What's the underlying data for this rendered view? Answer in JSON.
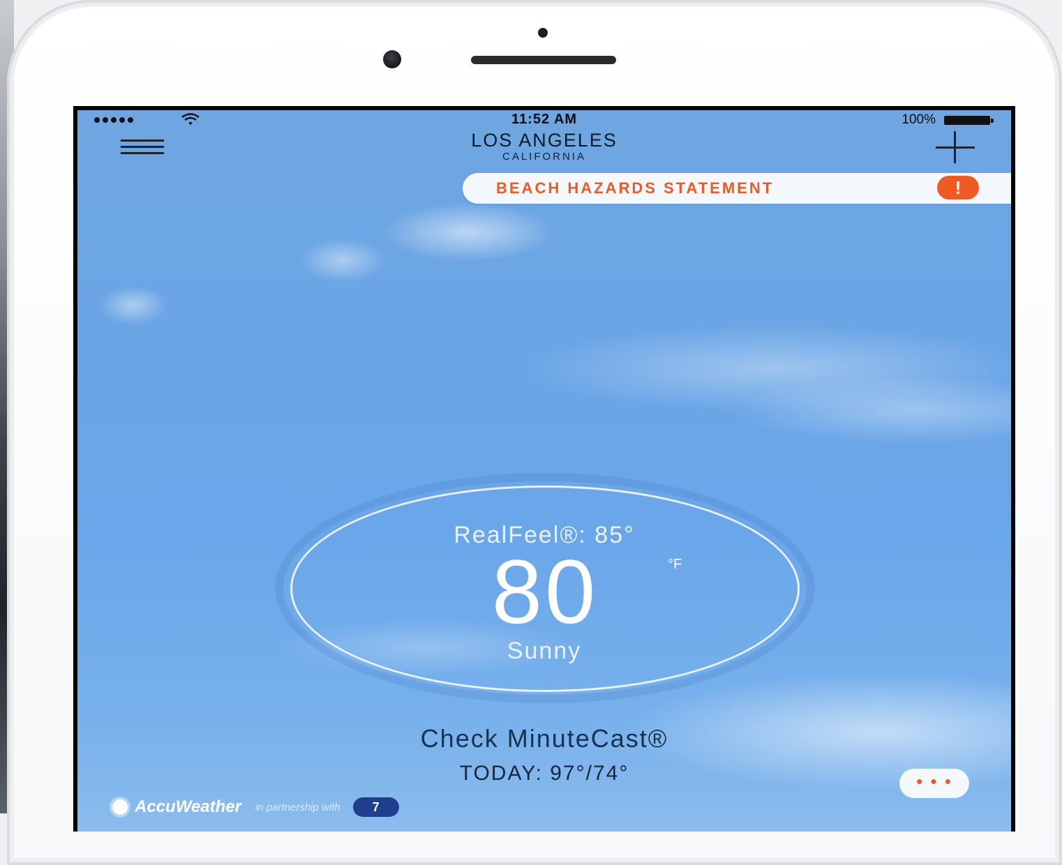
{
  "status_bar": {
    "time": "11:52 AM",
    "battery_percent": "100%",
    "signal_bars": 5
  },
  "header": {
    "city": "LOS ANGELES",
    "region": "CALIFORNIA"
  },
  "alert": {
    "label": "BEACH HAZARDS STATEMENT",
    "icon_glyph": "!"
  },
  "current": {
    "realfeel": "RealFeel®: 85°",
    "temperature": "80",
    "unit": "°F",
    "condition": "Sunny"
  },
  "minutecast_label": "Check MinuteCast®",
  "today_range": "TODAY: 97°/74°",
  "more_glyph": "• • •",
  "footer": {
    "brand": "AccuWeather",
    "partner_text": "in partnership with",
    "partner_logo": "7"
  },
  "colors": {
    "accent": "#ef5a22",
    "sky_top": "#6fa6e2",
    "sky_bottom": "#8bbcec"
  },
  "icons": [
    "menu-icon",
    "add-icon",
    "wifi-icon",
    "battery-icon",
    "alert-icon",
    "sun-icon"
  ]
}
